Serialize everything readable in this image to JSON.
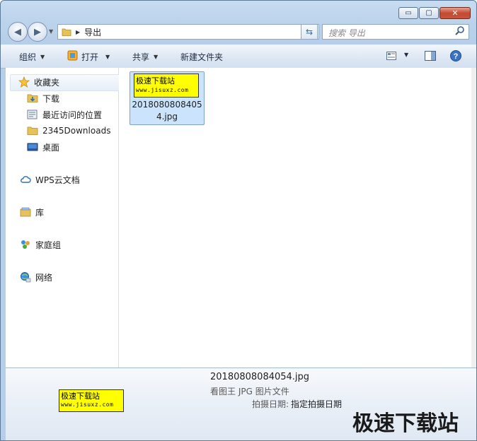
{
  "window": {
    "caption_buttons": [
      "▭",
      "▢",
      "✕"
    ]
  },
  "nav": {
    "address_path": "导出",
    "search_placeholder": "搜索 导出"
  },
  "toolbar": {
    "organize": "组织",
    "open": "打开",
    "share": "共享",
    "new_folder": "新建文件夹"
  },
  "sidebar": {
    "favorites": "收藏夹",
    "downloads": "下载",
    "recent": "最近访问的位置",
    "folder_2345": "2345Downloads",
    "desktop": "桌面",
    "wps": "WPS云文档",
    "library": "库",
    "homegroup": "家庭组",
    "network": "网络"
  },
  "files": [
    {
      "name_line1": "2018080808405",
      "name_line2": "4.jpg",
      "thumb_title": "极速下载站",
      "thumb_url": "www.jisuxz.com"
    }
  ],
  "details": {
    "file_name": "20180808084054.jpg",
    "file_type": "看图王 JPG 图片文件",
    "date_label": "拍摄日期:",
    "date_value": "指定拍摄日期",
    "thumb_title": "极速下载站",
    "thumb_url": "www.jisuxz.com"
  },
  "watermark": "极速下载站",
  "colors": {
    "selection": "#cce4fb",
    "thumb_bg": "#ffff00",
    "toolbar_text": "#1e2d44"
  },
  "icons": [
    "back-icon",
    "forward-icon",
    "folder-icon",
    "refresh-icon",
    "search-icon",
    "open-app-icon",
    "view-icon",
    "preview-pane-icon",
    "help-icon",
    "star-icon",
    "download-folder-icon",
    "recent-icon",
    "desktop-icon",
    "cloud-icon",
    "library-icon",
    "homegroup-icon",
    "network-icon"
  ]
}
